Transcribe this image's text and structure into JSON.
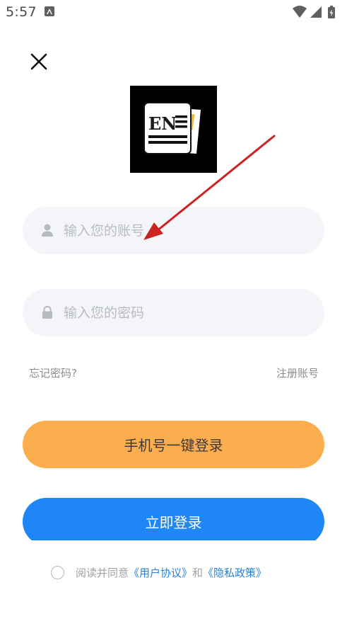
{
  "status_bar": {
    "time": "5:57",
    "icons": [
      "notification-a-icon",
      "wifi-icon",
      "signal-icon",
      "battery-charging-icon"
    ]
  },
  "logo": {
    "letters": "EN"
  },
  "account_field": {
    "placeholder": "输入您的账号",
    "value": "",
    "icon": "user-icon"
  },
  "password_field": {
    "placeholder": "输入您的密码",
    "value": "",
    "icon": "lock-icon"
  },
  "links": {
    "forgot_password": "忘记密码?",
    "register": "注册账号"
  },
  "buttons": {
    "phone_login": "手机号一键登录",
    "login_now": "立即登录"
  },
  "agreement": {
    "prefix": "阅读并同意",
    "user_agreement": "《用户协议》",
    "conjunction": "和",
    "privacy_policy": "《隐私政策》",
    "checked": false
  },
  "colors": {
    "phone_login_bg": "#fcad4e",
    "login_now_bg": "#1e86f7",
    "link_blue": "#2a82d9",
    "input_bg": "#f4f5f9",
    "annotation_arrow": "#cc2222"
  }
}
